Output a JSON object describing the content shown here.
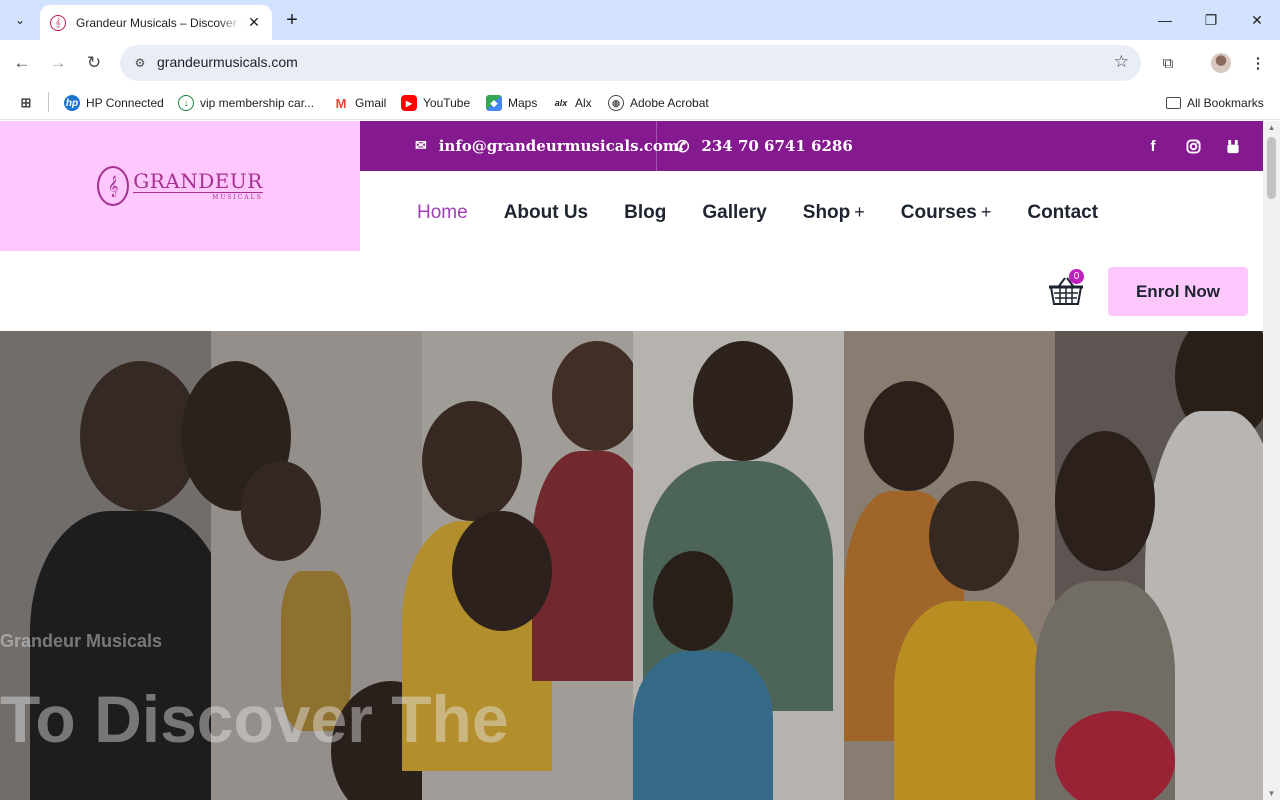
{
  "browser": {
    "tab_title": "Grandeur Musicals – Discover the",
    "url": "grandeurmusicals.com",
    "bookmarks": [
      {
        "label": "HP Connected",
        "icon": "hp-icon"
      },
      {
        "label": "vip membership car...",
        "icon": "download-icon"
      },
      {
        "label": "Gmail",
        "icon": "gmail-icon"
      },
      {
        "label": "YouTube",
        "icon": "youtube-icon"
      },
      {
        "label": "Maps",
        "icon": "maps-icon"
      },
      {
        "label": "Alx",
        "icon": "alx-icon"
      },
      {
        "label": "Adobe Acrobat",
        "icon": "globe-icon"
      }
    ],
    "all_bookmarks": "All Bookmarks"
  },
  "site": {
    "logo_text": "GRANDEUR",
    "logo_sub": "MUSICALS",
    "email": "info@grandeurmusicals.com",
    "phone": "234 70 6741 6286",
    "nav": [
      {
        "label": "Home",
        "active": true
      },
      {
        "label": "About Us"
      },
      {
        "label": "Blog"
      },
      {
        "label": "Gallery"
      },
      {
        "label": "Shop",
        "has_submenu": true
      },
      {
        "label": "Courses",
        "has_submenu": true
      },
      {
        "label": "Contact"
      }
    ],
    "submenu_indicator": "+",
    "cart_count": "0",
    "enrol_label": "Enrol Now",
    "hero_subtitle": "Grandeur Musicals",
    "hero_title": "To Discover The",
    "accent_color": "#85198f",
    "logo_bg": "#fec8fe"
  }
}
